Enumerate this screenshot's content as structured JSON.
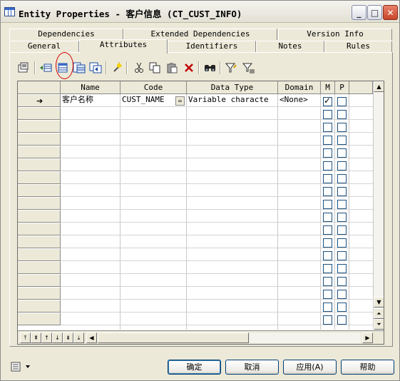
{
  "window": {
    "title": "Entity Properties - 客户信息 (CT_CUST_INFO)",
    "controls": {
      "minimize": "_",
      "maximize": "□",
      "close": "✕"
    }
  },
  "tabs": {
    "row1": [
      "Dependencies",
      "Extended Dependencies",
      "Version Info"
    ],
    "row2": [
      "General",
      "Attributes",
      "Identifiers",
      "Notes",
      "Rules"
    ],
    "active": "Attributes"
  },
  "toolbar": {
    "icons": [
      "properties-icon",
      "insert-row-icon",
      "add-row-icon",
      "add-attributes-icon",
      "reuse-attributes-icon",
      "new-icon",
      "cut-icon",
      "copy-icon",
      "paste-icon",
      "delete-icon",
      "find-icon",
      "customize-columns-icon",
      "filter-icon"
    ]
  },
  "grid": {
    "columns": [
      "Name",
      "Code",
      "Data Type",
      "Domain",
      "M",
      "P"
    ],
    "rows": [
      {
        "name": "客户名称",
        "code": "CUST_NAME",
        "data_type": "Variable characte",
        "domain": "<None>",
        "m": true,
        "p": false
      }
    ],
    "current_row_marker": "➔",
    "code_button": "="
  },
  "footer": {
    "ok": "确定",
    "cancel": "取消",
    "apply": "应用(A)",
    "help": "帮助"
  }
}
